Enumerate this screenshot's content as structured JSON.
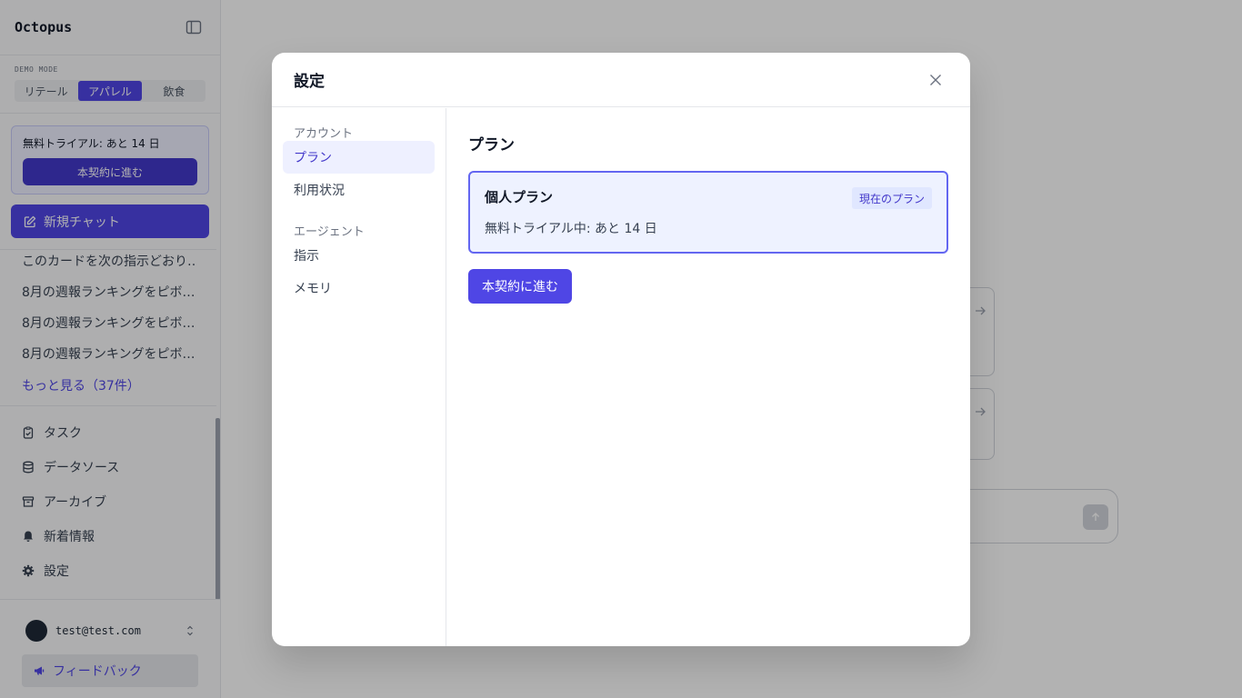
{
  "sidebar": {
    "logo": "Octopus",
    "demo_mode_label": "DEMO MODE",
    "demo_tabs": [
      {
        "label": "リテール",
        "active": false
      },
      {
        "label": "アパレル",
        "active": true
      },
      {
        "label": "飲食",
        "active": false
      }
    ],
    "trial_text": "無料トライアル: あと 14 日",
    "trial_button": "本契約に進む",
    "new_chat": "新規チャット",
    "history": [
      "このカードを次の指示どおり…",
      "8月の週報ランキングをピボ…",
      "8月の週報ランキングをピボ…",
      "8月の週報ランキングをピボ…"
    ],
    "more_link": "もっと見る（37件）",
    "nav": [
      {
        "label": "タスク",
        "icon": "clipboard-check-icon"
      },
      {
        "label": "データソース",
        "icon": "database-icon"
      },
      {
        "label": "アーカイブ",
        "icon": "archive-icon"
      },
      {
        "label": "新着情報",
        "icon": "bell-icon"
      },
      {
        "label": "設定",
        "icon": "gear-icon"
      }
    ],
    "user_email": "test@test.com",
    "feedback": "フィードバック"
  },
  "modal": {
    "title": "設定",
    "nav_sections": [
      {
        "heading": "アカウント",
        "items": [
          {
            "label": "プラン",
            "active": true
          },
          {
            "label": "利用状況",
            "active": false
          }
        ]
      },
      {
        "heading": "エージェント",
        "items": [
          {
            "label": "指示",
            "active": false
          },
          {
            "label": "メモリ",
            "active": false
          }
        ]
      }
    ],
    "section_title": "プラン",
    "plan": {
      "name": "個人プラン",
      "badge": "現在のプラン",
      "status": "無料トライアル中: あと 14 日"
    },
    "upgrade_button": "本契約に進む"
  },
  "colors": {
    "accent": "#4f46e5",
    "overlay": "rgba(0,0,0,0.30)"
  }
}
